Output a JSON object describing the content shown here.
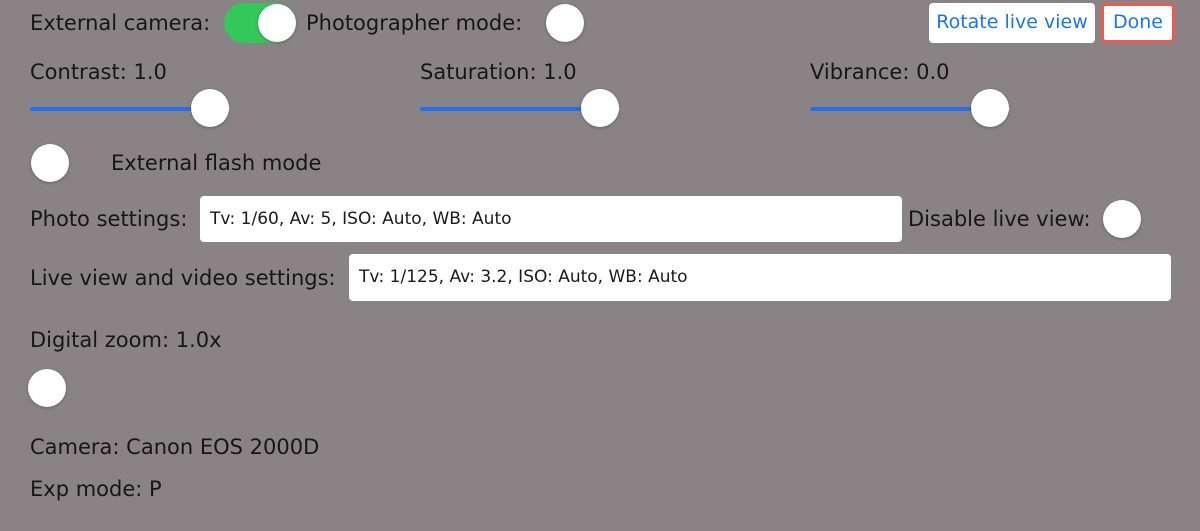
{
  "top": {
    "external_camera_label": "External camera:",
    "external_camera_on": true,
    "photographer_mode_label": "Photographer mode:",
    "photographer_mode_on": false,
    "rotate_live_view_label": "Rotate live view",
    "done_label": "Done"
  },
  "sliders": {
    "contrast": {
      "label": "Contrast: 1.0",
      "level": 0.9
    },
    "saturation": {
      "label": "Saturation: 1.0",
      "level": 0.9
    },
    "vibrance": {
      "label": "Vibrance: 0.0",
      "level": 0.9
    }
  },
  "flash": {
    "label": "External flash mode",
    "on": false
  },
  "photo_settings": {
    "label": "Photo settings:",
    "value": "Tv: 1/60, Av: 5, ISO: Auto, WB: Auto"
  },
  "disable_live_view": {
    "label": "Disable live view:",
    "on": false
  },
  "live_view_settings": {
    "label": "Live view and video settings:",
    "value": "Tv: 1/125, Av: 3.2, ISO: Auto, WB: Auto"
  },
  "digital_zoom": {
    "label": "Digital zoom: 1.0x",
    "on": false
  },
  "info": {
    "camera": "Camera: Canon EOS 2000D",
    "exp_mode": "Exp mode: P"
  },
  "colors": {
    "background": "#8a8385",
    "toggle_on": "#34c759",
    "accent_blue": "#1f6ff2",
    "button_text": "#1877e8",
    "done_highlight": "#f05a4e"
  }
}
